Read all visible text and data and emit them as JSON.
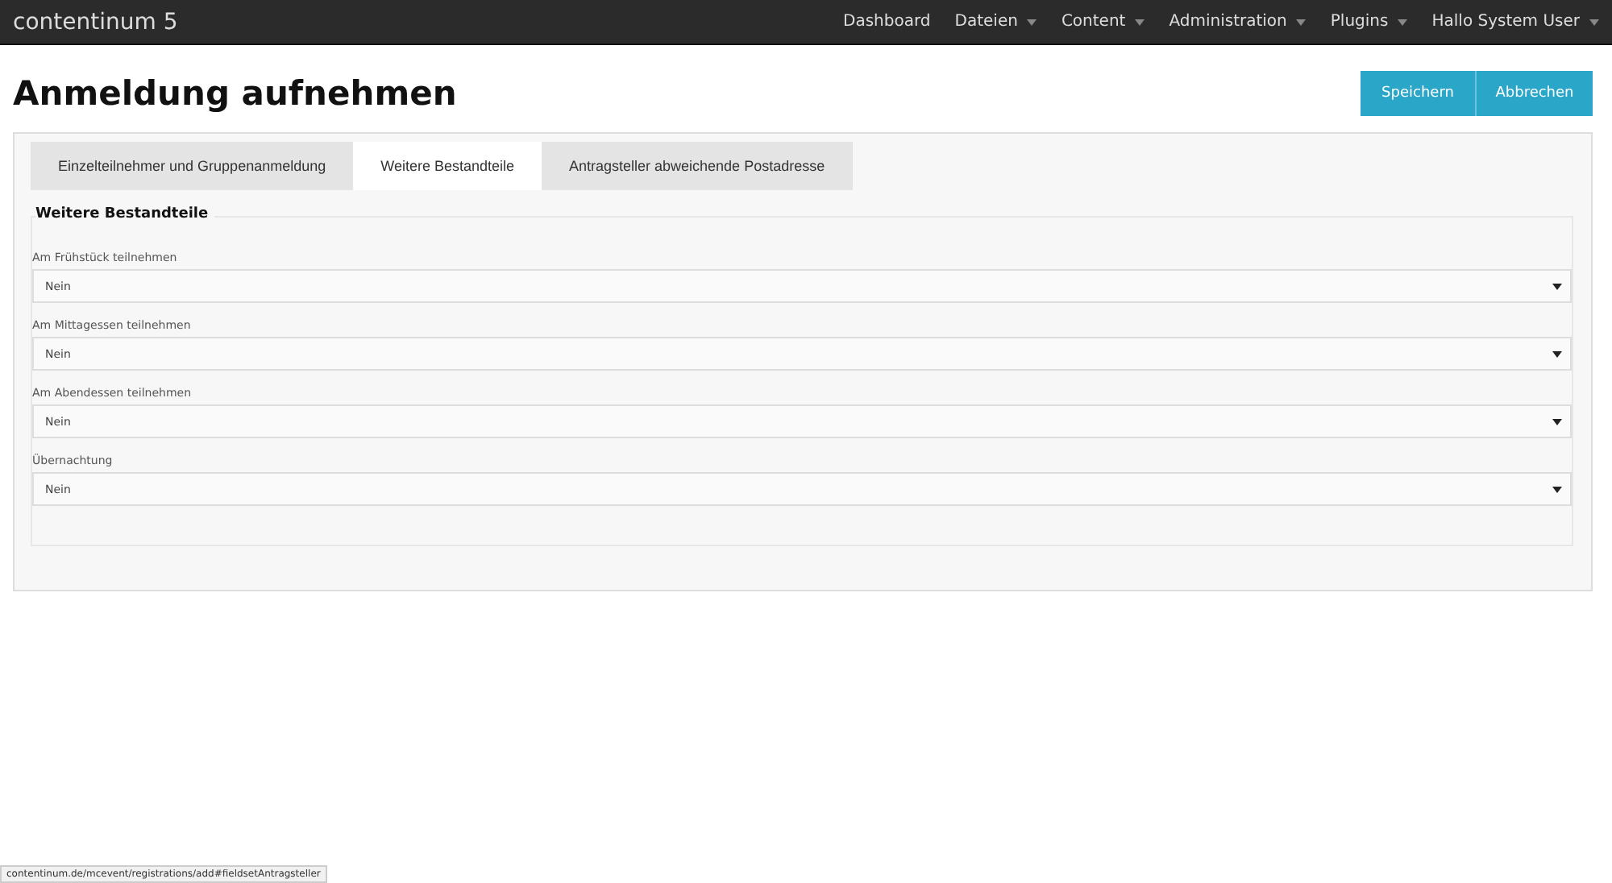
{
  "navbar": {
    "brand": "contentinum 5",
    "items": [
      {
        "label": "Dashboard",
        "dropdown": false
      },
      {
        "label": "Dateien",
        "dropdown": true
      },
      {
        "label": "Content",
        "dropdown": true
      },
      {
        "label": "Administration",
        "dropdown": true
      },
      {
        "label": "Plugins",
        "dropdown": true
      },
      {
        "label": "Hallo System User",
        "dropdown": true
      }
    ]
  },
  "page": {
    "title": "Anmeldung aufnehmen",
    "buttons": [
      "Speichern",
      "Abbrechen"
    ]
  },
  "tabs": [
    {
      "label": "Einzelteilnehmer und Gruppenanmeldung",
      "selected": false
    },
    {
      "label": "Weitere Bestandteile",
      "selected": true
    },
    {
      "label": "Antragsteller abweichende Postadresse",
      "selected": false
    }
  ],
  "fieldset": {
    "legend": "Weitere Bestandteile",
    "fields": [
      {
        "label": "Am Frühstück teilnehmen",
        "value": "Nein"
      },
      {
        "label": "Am Mittagessen teilnehmen",
        "value": "Nein"
      },
      {
        "label": "Am Abendessen teilnehmen",
        "value": "Nein"
      },
      {
        "label": "Übernachtung",
        "value": "Nein"
      }
    ]
  },
  "status_bar": {
    "url": "contentinum.de/mcevent/registrations/add#fieldsetAntragsteller"
  }
}
